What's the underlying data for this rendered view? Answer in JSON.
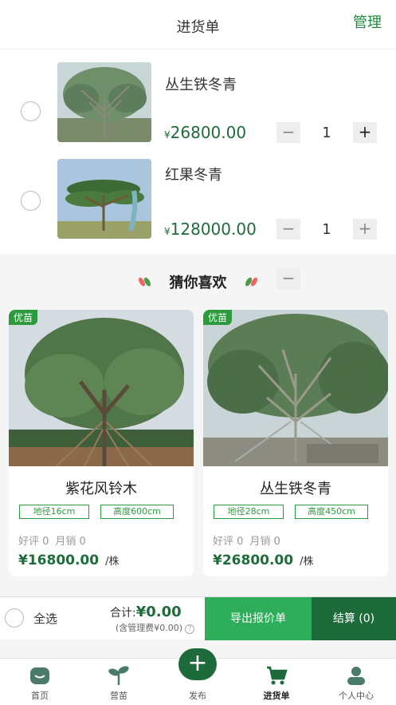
{
  "header": {
    "title": "进货单",
    "manage_label": "管理"
  },
  "cart": {
    "items": [
      {
        "name": "丛生铁冬青",
        "currency": "¥",
        "price": "26800.00",
        "quantity": "1"
      },
      {
        "name": "红果冬青",
        "currency": "¥",
        "price": "128000.00",
        "quantity": "1"
      }
    ],
    "minus_symbol": "−",
    "plus_symbol": "+"
  },
  "recommend": {
    "title": "猜你喜欢",
    "cards": [
      {
        "badge": "优苗",
        "name": "紫花风铃木",
        "tag1": "地径16cm",
        "tag2": "高度600cm",
        "reviews": "好评 0",
        "sales": "月销 0",
        "price": "¥16800.00",
        "unit": "/株"
      },
      {
        "badge": "优苗",
        "name": "丛生铁冬青",
        "tag1": "地径28cm",
        "tag2": "高度450cm",
        "reviews": "好评 0",
        "sales": "月销 0",
        "price": "¥26800.00",
        "unit": "/株"
      }
    ]
  },
  "bottom_bar": {
    "select_all": "全选",
    "total_label": "合计:",
    "total_amount": "¥0.00",
    "fee_note": "(含管理费¥0.00)",
    "help_symbol": "?",
    "export_label": "导出报价单",
    "checkout_label": "结算 (0)"
  },
  "tabbar": {
    "items": [
      {
        "label": "首页",
        "icon": "home-icon"
      },
      {
        "label": "营苗",
        "icon": "seedling-icon"
      },
      {
        "label": "发布",
        "icon": "plus-icon"
      },
      {
        "label": "进货单",
        "icon": "cart-icon"
      },
      {
        "label": "个人中心",
        "icon": "user-icon"
      }
    ],
    "publish_symbol": "+"
  },
  "colors": {
    "brand_green": "#1f8a3a",
    "dark_green": "#1d6b3b",
    "price_green": "#1f6b3a"
  }
}
